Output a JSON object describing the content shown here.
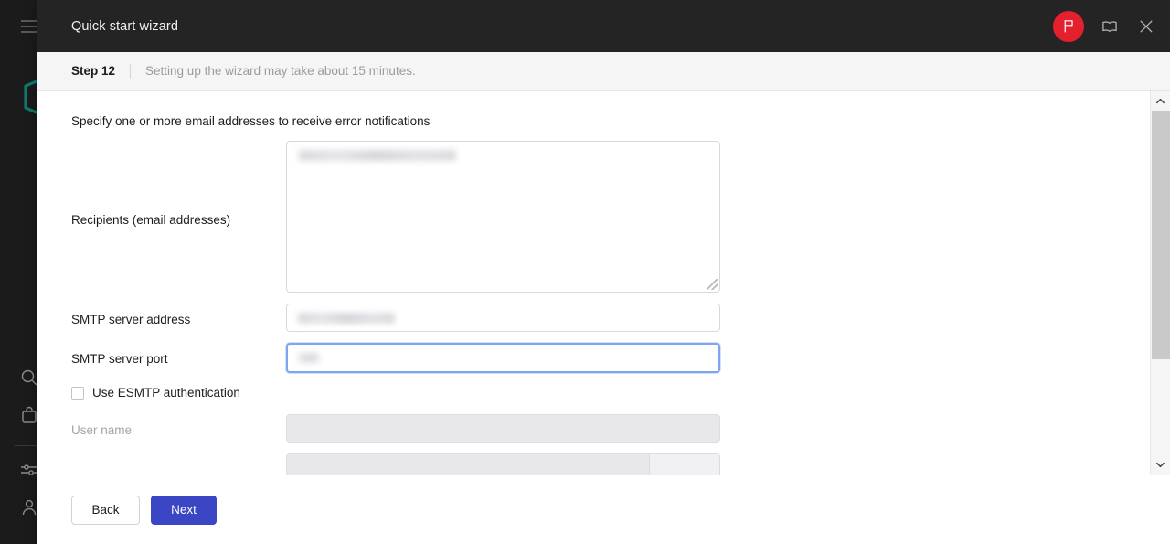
{
  "app": {
    "sidebar": {
      "menu_icon": "hamburger-icon",
      "logo": "hexagon-logo",
      "logo_color": "#0e7a6b",
      "items": [
        {
          "icon": "search-icon",
          "label": "Search"
        },
        {
          "icon": "briefcase-icon",
          "label": "Products"
        },
        {
          "icon": "sliders-icon",
          "label": "Settings"
        },
        {
          "icon": "user-icon",
          "label": "Account"
        }
      ]
    }
  },
  "modal": {
    "title": "Quick start wizard",
    "header_actions": [
      {
        "name": "flag-button",
        "icon": "flag-icon",
        "color": "#e5202e"
      },
      {
        "name": "manual-button",
        "icon": "book-icon"
      },
      {
        "name": "close-button",
        "icon": "close-icon"
      }
    ],
    "step": {
      "label": "Step 12",
      "note": "Setting up the wizard may take about 15 minutes."
    },
    "form": {
      "heading": "Specify one or more email addresses to receive error notifications",
      "fields": [
        {
          "name": "recipients",
          "label": "Recipients (email addresses)",
          "type": "textarea",
          "value": "",
          "redacted": true,
          "resizable": true
        },
        {
          "name": "smtp-server-address",
          "label": "SMTP server address",
          "type": "text",
          "value": "",
          "redacted": true,
          "focused": false
        },
        {
          "name": "smtp-server-port",
          "label": "SMTP server port",
          "type": "text",
          "value": "",
          "redacted": true,
          "focused": true
        }
      ],
      "checkbox": {
        "name": "use-esmtp-authentication",
        "label": "Use ESMTP authentication",
        "checked": false
      },
      "auth_fields": [
        {
          "name": "user-name",
          "label": "User name",
          "type": "text",
          "value": "",
          "disabled": true
        },
        {
          "name": "password",
          "label": "",
          "type": "password",
          "value": "",
          "disabled": true,
          "button_label": ""
        }
      ]
    },
    "footer": {
      "back_label": "Back",
      "next_label": "Next",
      "next_color": "#3b46c4"
    },
    "scrollbar": {
      "up_arrow": "chevron-up-icon",
      "down_arrow": "chevron-down-icon",
      "thumb_position": 0
    }
  }
}
